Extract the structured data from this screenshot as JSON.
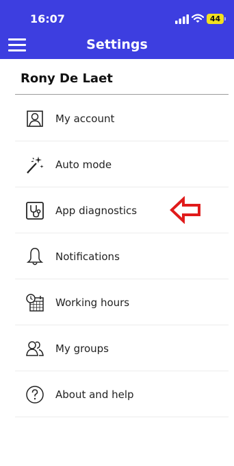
{
  "status_bar": {
    "time": "16:07",
    "battery_level": "44",
    "signal_icon": "cellular-signal-icon",
    "wifi_icon": "wifi-icon"
  },
  "header": {
    "title": "Settings",
    "menu_icon": "hamburger-menu-icon",
    "background_color": "#3d3ee0"
  },
  "user": {
    "name": "Rony De Laet"
  },
  "menu": {
    "items": [
      {
        "label": "My account",
        "icon": "account-icon"
      },
      {
        "label": "Auto mode",
        "icon": "magic-wand-icon"
      },
      {
        "label": "App diagnostics",
        "icon": "stethoscope-icon"
      },
      {
        "label": "Notifications",
        "icon": "bell-icon"
      },
      {
        "label": "Working hours",
        "icon": "calendar-clock-icon"
      },
      {
        "label": "My groups",
        "icon": "group-icon"
      },
      {
        "label": "About and help",
        "icon": "help-icon"
      }
    ]
  },
  "annotation": {
    "icon": "red-arrow-icon",
    "color": "#e01b1b"
  }
}
